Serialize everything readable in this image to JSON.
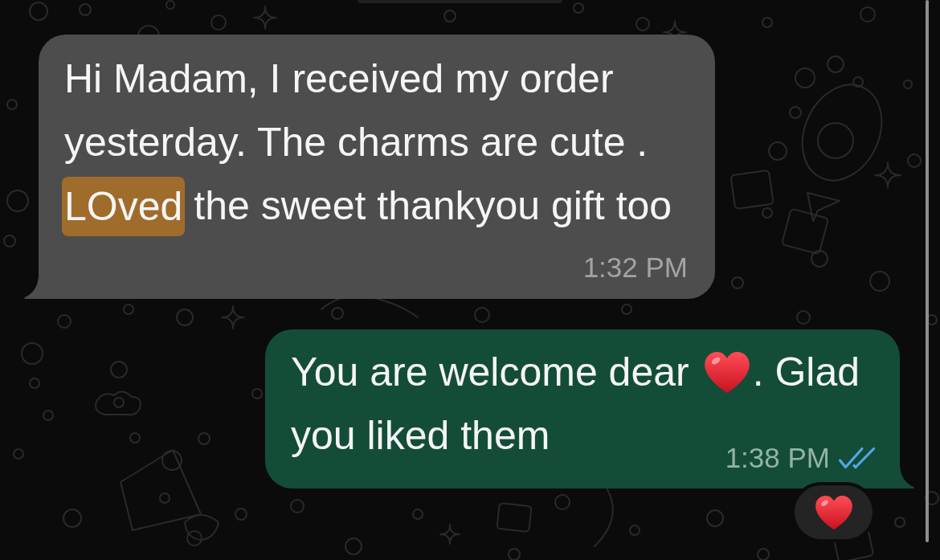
{
  "messages": [
    {
      "kind": "incoming",
      "parts": [
        {
          "kind": "text",
          "text": "Hi Madam, I received my order yesterday. The charms are cute .",
          "highlighted": false
        },
        {
          "kind": "text",
          "text": "LOved",
          "highlighted": true
        },
        {
          "kind": "text",
          "text": "the sweet thankyou gift too",
          "highlighted": false
        }
      ],
      "time": "1:32 PM"
    },
    {
      "kind": "outgoing",
      "parts": [
        {
          "kind": "text",
          "text": "You are welcome dear",
          "highlighted": false
        },
        {
          "kind": "emoji",
          "highlighted": false
        },
        {
          "kind": "text",
          "text": ". Glad",
          "highlighted": false
        },
        {
          "kind": "text",
          "text": "you liked them",
          "highlighted": false
        }
      ],
      "time": "1:38 PM",
      "read": true,
      "reacted": true
    }
  ]
}
